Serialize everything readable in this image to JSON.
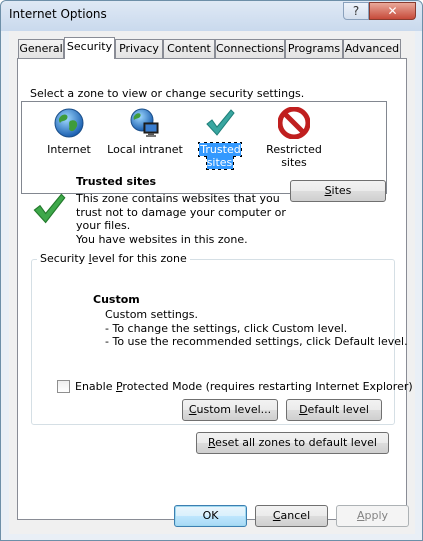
{
  "window": {
    "title": "Internet Options",
    "help_glyph": "?",
    "close_glyph": "✕"
  },
  "tabs": [
    {
      "label": "General"
    },
    {
      "label": "Security"
    },
    {
      "label": "Privacy"
    },
    {
      "label": "Content"
    },
    {
      "label": "Connections"
    },
    {
      "label": "Programs"
    },
    {
      "label": "Advanced"
    }
  ],
  "security": {
    "select_zone_text": "Select a zone to view or change security settings.",
    "zones": [
      {
        "label": "Internet",
        "icon": "globe-icon"
      },
      {
        "label": "Local intranet",
        "icon": "intranet-icon"
      },
      {
        "label": "Trusted sites",
        "icon": "checkmark-icon",
        "selected": true
      },
      {
        "label_line1": "Restricted",
        "label_line2": "sites",
        "icon": "restricted-icon"
      }
    ],
    "zone_title": "Trusted sites",
    "zone_description": [
      "This zone contains websites that you",
      "trust not to damage your computer or",
      "your files.",
      "You have websites in this zone."
    ],
    "sites_button": {
      "pre": "",
      "u": "S",
      "post": "ites"
    },
    "level_group_title": {
      "pre": "Security ",
      "u": "l",
      "post": "evel for this zone"
    },
    "level_name": "Custom",
    "level_lines": [
      "Custom settings.",
      "- To change the settings, click Custom level.",
      "- To use the recommended settings, click Default level."
    ],
    "protected_mode": {
      "pre": "Enable ",
      "u": "P",
      "post": "rotected Mode (requires restarting Internet Explorer)",
      "checked": false
    },
    "custom_level_button": {
      "pre": "",
      "u": "C",
      "post": "ustom level..."
    },
    "default_level_button": {
      "pre": "",
      "u": "D",
      "post": "efault level"
    },
    "reset_button": {
      "pre": "",
      "u": "R",
      "post": "eset all zones to default level"
    }
  },
  "footer": {
    "ok": "OK",
    "cancel": {
      "pre": "",
      "u": "C",
      "post": "ancel"
    },
    "apply": {
      "pre": "",
      "u": "A",
      "post": "pply"
    }
  },
  "colors": {
    "selection": "#3399ff",
    "check_green": "#3ea84a",
    "restricted_red": "#d42a2a"
  }
}
